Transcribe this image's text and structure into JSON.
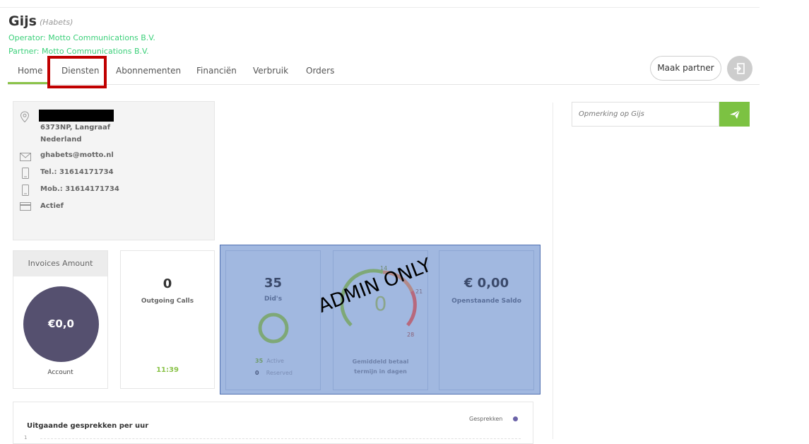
{
  "header": {
    "name": "Gijs",
    "surname": "(Habets)",
    "operator": "Operator: Motto Communications B.V.",
    "partner": "Partner: Motto Communications B.V."
  },
  "tabs": [
    {
      "label": "Home"
    },
    {
      "label": "Diensten"
    },
    {
      "label": "Abonnementen"
    },
    {
      "label": "Financiën"
    },
    {
      "label": "Verbruik"
    },
    {
      "label": "Orders"
    }
  ],
  "buttons": {
    "maak_partner": "Maak partner"
  },
  "remark": {
    "placeholder": "Opmerking op Gijs"
  },
  "contact": {
    "address_line1": "6373NP, Langraaf",
    "address_line2": "Nederland",
    "email": "ghabets@motto.nl",
    "tel": "Tel.: 31614171734",
    "mob": "Mob.: 31614171734",
    "status": "Actief"
  },
  "invoices": {
    "header": "Invoices Amount",
    "amount": "€0,0",
    "label": "Account"
  },
  "outgoing": {
    "count": "0",
    "label": "Outgoing Calls",
    "time": "11:39"
  },
  "dids": {
    "count": "35",
    "label": "Did's",
    "active_count": "35",
    "active_label": "Active",
    "reserved_count": "0",
    "reserved_label": "Reserved"
  },
  "payment_term": {
    "value": "0",
    "tick_14": "14",
    "tick_21": "21",
    "tick_28": "28",
    "label_line1": "Gemiddeld betaal",
    "label_line2": "termijn in dagen"
  },
  "saldo": {
    "amount": "€ 0,00",
    "label": "Openstaande Saldo"
  },
  "overlay": {
    "text": "ADMIN ONLY"
  },
  "calls_chart": {
    "title": "Uitgaande gesprekken per uur",
    "legend": "Gesprekken",
    "first_tick": "1"
  },
  "colors": {
    "accent_green": "#8bc34a",
    "link_green": "#3cd07a",
    "send_green": "#7cc242",
    "invoice_circle": "#55506f",
    "admin_overlay": "#a1b8e0",
    "highlight_red": "#c00000"
  }
}
